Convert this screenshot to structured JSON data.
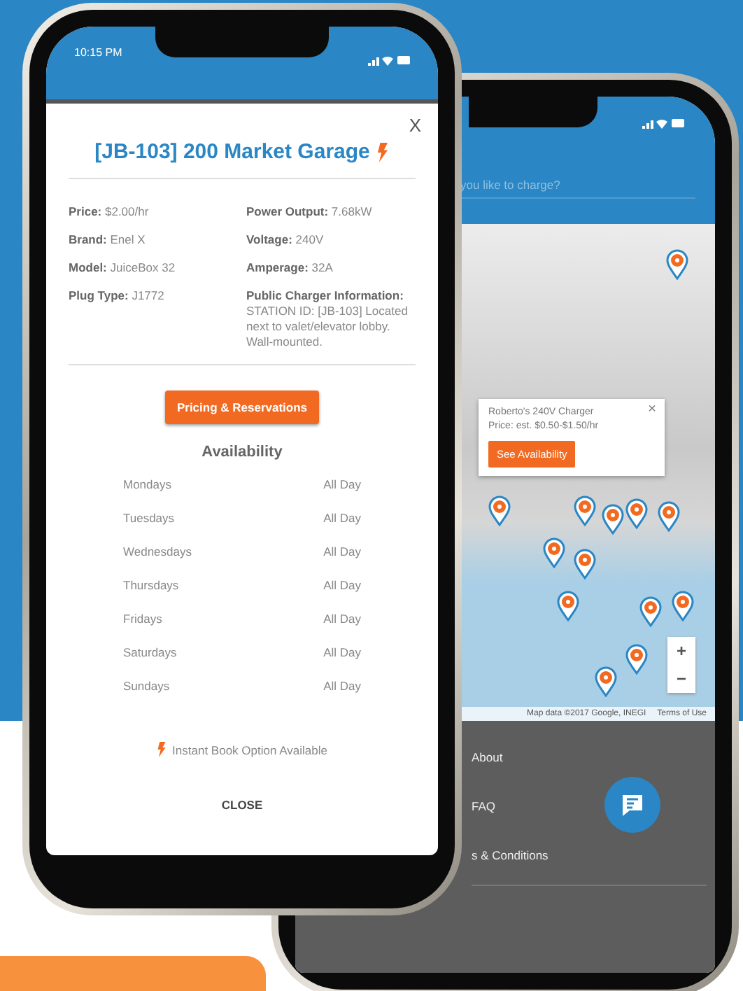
{
  "front_phone": {
    "status_bar": {
      "time": "10:15 PM"
    },
    "charger_modal": {
      "close": "X",
      "title": "[JB-103] 200 Market Garage",
      "details_left": [
        {
          "label": "Price:",
          "value": "$2.00/hr"
        },
        {
          "label": "Brand:",
          "value": "Enel X"
        },
        {
          "label": "Model:",
          "value": "JuiceBox 32"
        },
        {
          "label": "Plug Type:",
          "value": "J1772"
        }
      ],
      "details_right": [
        {
          "label": "Power Output:",
          "value": "7.68kW"
        },
        {
          "label": "Voltage:",
          "value": "240V"
        },
        {
          "label": "Amperage:",
          "value": "32A"
        },
        {
          "label": "Public Charger Information:",
          "value": "STATION ID: [JB-103] Located next to valet/elevator lobby. Wall-mounted."
        }
      ],
      "pricing_button": "Pricing & Reservations",
      "availability_heading": "Availability",
      "availability": [
        {
          "day": "Mondays",
          "hours": "All Day"
        },
        {
          "day": "Tuesdays",
          "hours": "All Day"
        },
        {
          "day": "Wednesdays",
          "hours": "All Day"
        },
        {
          "day": "Thursdays",
          "hours": "All Day"
        },
        {
          "day": "Fridays",
          "hours": "All Day"
        },
        {
          "day": "Saturdays",
          "hours": "All Day"
        },
        {
          "day": "Sundays",
          "hours": "All Day"
        }
      ],
      "instant_book_note": "Instant Book Option Available",
      "close_button": "CLOSE"
    }
  },
  "back_phone": {
    "search": {
      "placeholder": "you like to charge?"
    },
    "map": {
      "popup": {
        "title": "Roberto's 240V Charger",
        "price": "Price: est. $0.50-$1.50/hr",
        "close": "×",
        "button": "See Availability"
      },
      "zoom_in": "+",
      "zoom_out": "−",
      "attribution": "Map data ©2017 Google, INEGI",
      "terms_link": "Terms of Use"
    },
    "menu": [
      {
        "label": "About"
      },
      {
        "label": "FAQ"
      },
      {
        "label": "s & Conditions"
      }
    ]
  }
}
